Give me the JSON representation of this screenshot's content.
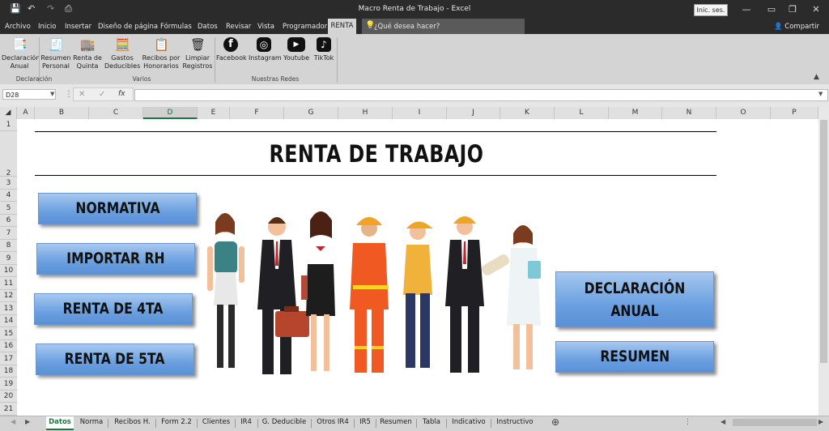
{
  "titlebar": {
    "title": "Macro Renta de Trabajo  -  Excel",
    "signin": "Inic. ses.",
    "qa_save": "💾",
    "qa_undo": "↶",
    "qa_redo": "↷",
    "qa_print": "⎙",
    "min": "—",
    "restore": "❐",
    "close": "✕"
  },
  "menu": {
    "items": [
      "Archivo",
      "Inicio",
      "Insertar",
      "Diseño de página",
      "Fórmulas",
      "Datos",
      "Revisar",
      "Vista",
      "Programador"
    ],
    "active": "RENTA",
    "tell_me": "¿Qué desea hacer?",
    "share": "Compartir"
  },
  "ribbon": {
    "buttons": [
      {
        "label": "Declaración\nAnual",
        "icon": "declaration-icon"
      },
      {
        "label": "Resumen\nPersonal",
        "icon": "summary-icon"
      },
      {
        "label": "Renta de\nQuinta",
        "icon": "fifth-rent-icon"
      },
      {
        "label": "Gastos\nDeducibles",
        "icon": "calculator-icon"
      },
      {
        "label": "Recibos por\nHonorarios",
        "icon": "receipts-icon"
      },
      {
        "label": "Limpiar\nRegistros",
        "icon": "trash-icon"
      },
      {
        "label": "Facebook",
        "icon": "facebook-icon"
      },
      {
        "label": "Instagram",
        "icon": "instagram-icon"
      },
      {
        "label": "Youtube",
        "icon": "youtube-icon"
      },
      {
        "label": "TikTok",
        "icon": "tiktok-icon"
      }
    ],
    "groups": [
      "Declaración",
      "Varios",
      "Nuestras Redes"
    ]
  },
  "formula_bar": {
    "name_box": "D28",
    "cancel": "✕",
    "enter": "✓",
    "fx": "fx",
    "value": ""
  },
  "columns": [
    "A",
    "B",
    "C",
    "D",
    "E",
    "F",
    "G",
    "H",
    "I",
    "J",
    "K",
    "L",
    "M",
    "N",
    "O",
    "P"
  ],
  "selected_column": "D",
  "rows": [
    "1",
    "2",
    "3",
    "4",
    "5",
    "6",
    "7",
    "8",
    "9",
    "10",
    "11",
    "12",
    "13",
    "14",
    "15",
    "16",
    "17",
    "18",
    "19",
    "20",
    "21"
  ],
  "content": {
    "title": "RENTA DE TRABAJO",
    "buttons_left": [
      "NORMATIVA",
      "IMPORTAR RH",
      "RENTA DE 4TA",
      "RENTA DE 5TA"
    ],
    "buttons_right": [
      "DECLARACIÓN\nANUAL",
      "RESUMEN"
    ]
  },
  "sheet_tabs": [
    "Datos",
    "Norma",
    "Recibos H.",
    "Form 2.2",
    "Clientes",
    "IR4",
    "G. Deducible",
    "Otros IR4",
    "IR5",
    "Resumen",
    "Tabla",
    "Indicativo",
    "Instructivo"
  ],
  "active_sheet": "Datos",
  "colors": {
    "accent_green": "#217346",
    "button_blue": "#6aa0e0",
    "dark_chrome": "#2b2b2b"
  }
}
